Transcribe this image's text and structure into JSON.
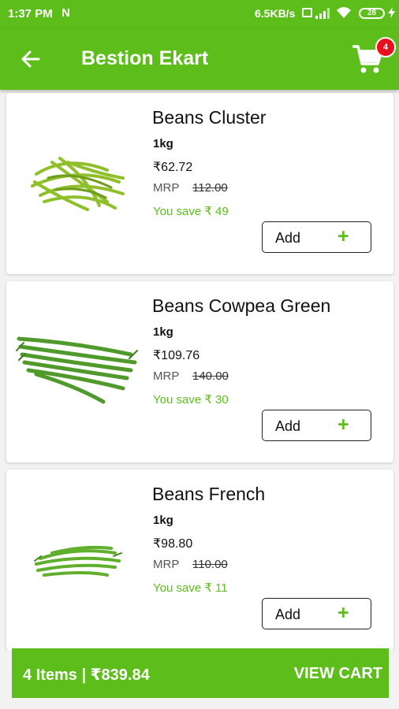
{
  "status_bar": {
    "time": "1:37 PM",
    "notification_icon": "N",
    "network_speed": "6.5KB/s",
    "battery_level": "28"
  },
  "app_bar": {
    "title": "Bestion Ekart",
    "back_icon": "arrow-left-icon",
    "cart_icon": "cart-icon",
    "cart_count": "4"
  },
  "products": [
    {
      "name": "Beans Cluster",
      "quantity": "1kg",
      "price": "₹62.72",
      "mrp_label": "MRP",
      "mrp": "112.00",
      "savings": "You save ₹ 49",
      "add_label": "Add",
      "add_icon": "plus-icon"
    },
    {
      "name": "Beans Cowpea Green",
      "quantity": "1kg",
      "price": "₹109.76",
      "mrp_label": "MRP",
      "mrp": "140.00",
      "savings": "You save ₹ 30",
      "add_label": "Add",
      "add_icon": "plus-icon"
    },
    {
      "name": "Beans French",
      "quantity": "1kg",
      "price": "₹98.80",
      "mrp_label": "MRP",
      "mrp": "110.00",
      "savings": "You save ₹ 11",
      "add_label": "Add",
      "add_icon": "plus-icon"
    }
  ],
  "bottom_bar": {
    "summary": "4 Items | ₹839.84",
    "view_cart_label": "VIEW CART"
  },
  "colors": {
    "primary": "#5cbd1b",
    "badge": "#e8101c",
    "save_text": "#5cbd1b"
  }
}
